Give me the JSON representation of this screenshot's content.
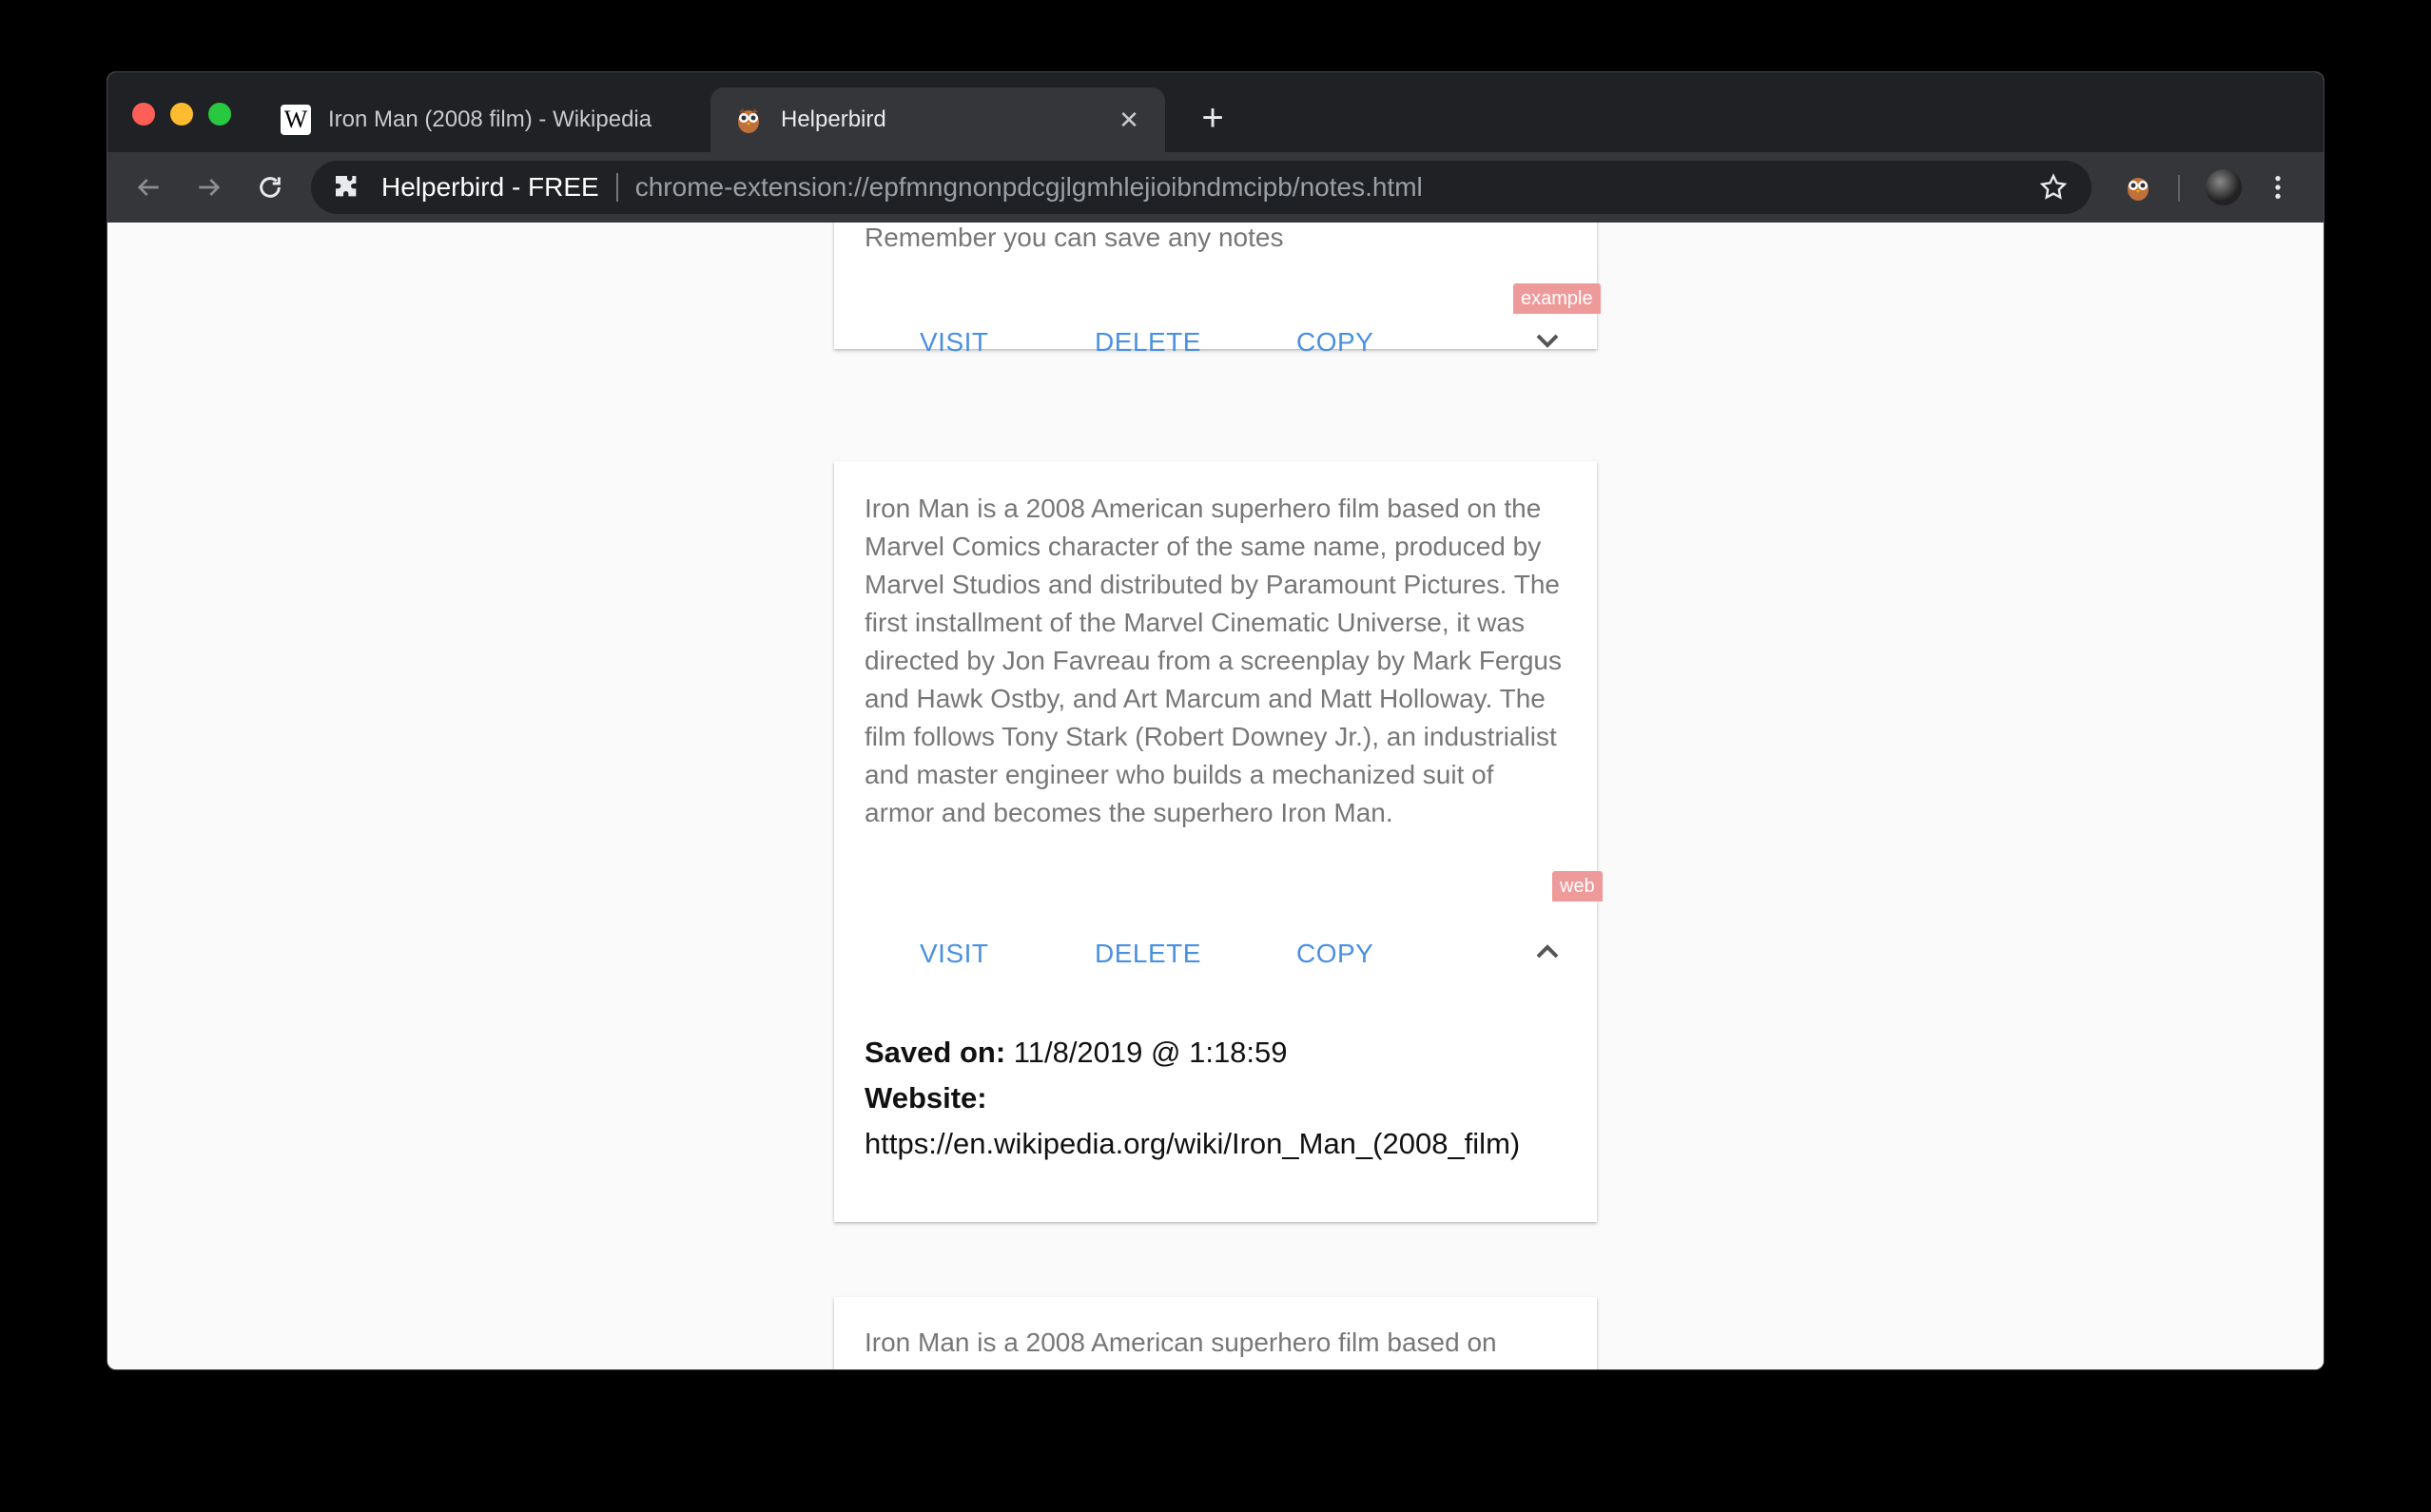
{
  "browser": {
    "tabs": [
      {
        "title": "Iron Man (2008 film) - Wikipedia",
        "favicon": "wikipedia-icon",
        "active": false
      },
      {
        "title": "Helperbird",
        "favicon": "owl-icon",
        "active": true
      }
    ],
    "omnibox": {
      "site": "Helperbird - FREE",
      "url": "chrome-extension://epfmngnonpdcgjlgmhlejioibndmcipb/notes.html"
    }
  },
  "notes": [
    {
      "text": "Remember you can save any notes",
      "tag": "example",
      "actions": {
        "visit": "VISIT",
        "delete": "DELETE",
        "copy": "COPY"
      },
      "expanded": false
    },
    {
      "text": "Iron Man is a 2008 American superhero film based on the Marvel Comics character of the same name, produced by Marvel Studios and distributed by Paramount Pictures. The first installment of the Marvel Cinematic Universe, it was directed by Jon Favreau from a screenplay by Mark Fergus and Hawk Ostby, and Art Marcum and Matt Holloway. The film follows Tony Stark (Robert Downey Jr.), an industrialist and master engineer who builds a mechanized suit of armor and becomes the superhero Iron Man.",
      "tag": "web",
      "actions": {
        "visit": "VISIT",
        "delete": "DELETE",
        "copy": "COPY"
      },
      "expanded": true,
      "saved_label": "Saved on:",
      "saved_value": "11/8/2019 @ 1:18:59",
      "website_label": "Website:",
      "website_value": "https://en.wikipedia.org/wiki/Iron_Man_(2008_film)"
    },
    {
      "text": "Iron Man is a 2008 American superhero film based on"
    }
  ],
  "colors": {
    "link": "#4a90e2",
    "tag": "#ef9a9a",
    "note_text": "#777777"
  }
}
